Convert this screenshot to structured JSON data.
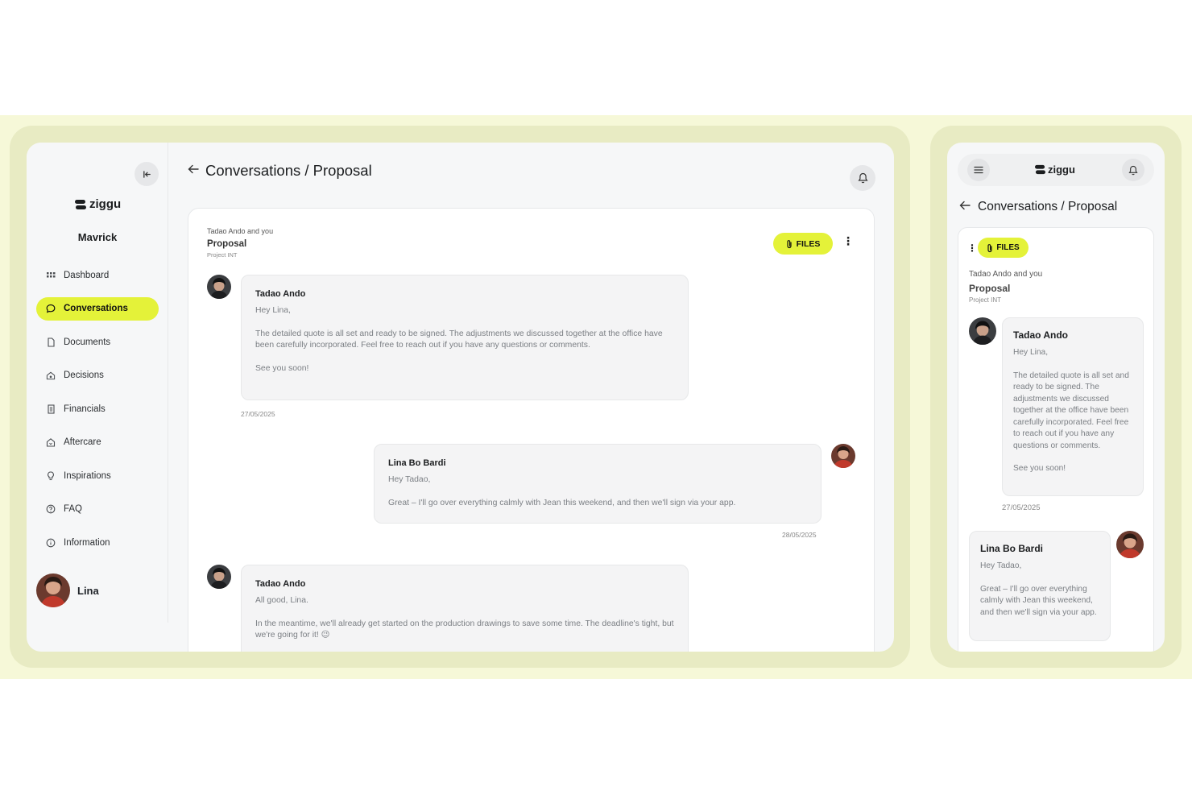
{
  "colors": {
    "accent": "#e4f239",
    "frame": "#e8ebc3",
    "band": "#f6f8d8"
  },
  "brand": "ziggu",
  "project_name": "Mavrick",
  "sidebar": {
    "items": [
      {
        "label": "Dashboard",
        "icon": "grid-icon"
      },
      {
        "label": "Conversations",
        "icon": "chat-bubble-icon",
        "active": true
      },
      {
        "label": "Documents",
        "icon": "document-icon"
      },
      {
        "label": "Decisions",
        "icon": "decisions-icon"
      },
      {
        "label": "Financials",
        "icon": "receipt-icon"
      },
      {
        "label": "Aftercare",
        "icon": "home-care-icon"
      },
      {
        "label": "Inspirations",
        "icon": "lightbulb-icon"
      },
      {
        "label": "FAQ",
        "icon": "question-icon"
      },
      {
        "label": "Information",
        "icon": "info-icon"
      }
    ],
    "user_name": "Lina"
  },
  "header": {
    "title": "Conversations / Proposal"
  },
  "conversation": {
    "participants": "Tadao Ando and you",
    "subject": "Proposal",
    "project": "Project INT",
    "files_label": "FILES",
    "messages": [
      {
        "sender": "Tadao Ando",
        "greeting": "Hey Lina,",
        "body": "The detailed quote is all set and ready to be signed. The adjustments we discussed together at the office have been carefully incorporated. Feel free to reach out if you have any questions or comments.",
        "closing": "See you soon!",
        "date": "27/05/2025"
      },
      {
        "sender": "Lina Bo Bardi",
        "greeting": "Hey Tadao,",
        "body": "Great – I'll go over everything calmly with Jean this weekend, and then we'll sign via your app.",
        "date": "28/05/2025"
      },
      {
        "sender": "Tadao Ando",
        "greeting": "All good, Lina.",
        "body": "In the meantime, we'll already get started on the production drawings to save some time. The deadline's tight, but we're going for it! 😉"
      }
    ]
  }
}
